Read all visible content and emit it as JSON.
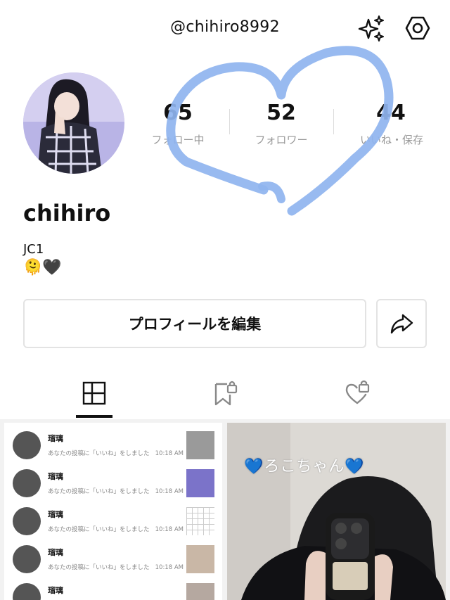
{
  "header": {
    "username": "@chihiro8992",
    "sparkle_icon": "sparkle-icon",
    "settings_icon": "hexagon-settings-icon"
  },
  "profile": {
    "display_name": "chihiro",
    "bio": "JC1",
    "emojis": "🫠🖤",
    "stats": [
      {
        "value": "65",
        "label": "フォロー中"
      },
      {
        "value": "52",
        "label": "フォロワー"
      },
      {
        "value": "44",
        "label": "いいね・保存"
      }
    ]
  },
  "actions": {
    "edit_profile": "プロフィールを編集",
    "share_icon": "share-arrow-icon"
  },
  "tabs": [
    {
      "icon": "grid-layout-icon",
      "active": true
    },
    {
      "icon": "bookmark-lock-icon",
      "active": false
    },
    {
      "icon": "heart-lock-icon",
      "active": false
    }
  ],
  "posts": {
    "post1": {
      "notifications": [
        {
          "name": "瑠璃",
          "text": "あなたの投稿に「いいね」をしました",
          "time": "10:18 AM"
        },
        {
          "name": "瑠璃",
          "text": "あなたの投稿に「いいね」をしました",
          "time": "10:18 AM"
        },
        {
          "name": "瑠璃",
          "text": "あなたの投稿に「いいね」をしました",
          "time": "10:18 AM"
        },
        {
          "name": "瑠璃",
          "text": "あなたの投稿に「いいね」をしました",
          "time": "10:18 AM"
        },
        {
          "name": "瑠璃",
          "text": "",
          "time": ""
        }
      ]
    },
    "post2": {
      "caption": "💙ろこちゃん💙"
    }
  },
  "colors": {
    "heart_doodle": "#8fb4ef",
    "muted_text": "#999999",
    "border": "#e3e3e3"
  }
}
